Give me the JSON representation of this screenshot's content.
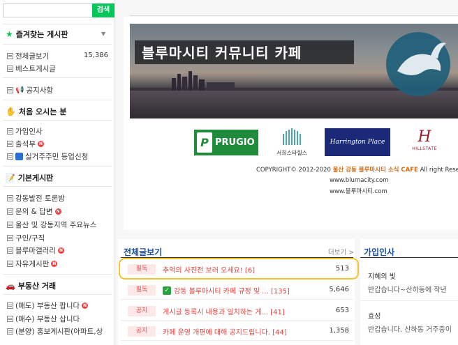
{
  "search": {
    "placeholder": "",
    "button": "검색"
  },
  "sidebar": {
    "favorites_title": "즐겨찾는 게시판",
    "items_top": [
      {
        "label": "전체글보기",
        "count": "15,386"
      },
      {
        "label": "베스트게시글"
      }
    ],
    "notice": "공지사항",
    "first_visit_title": "처음 오시는 분",
    "first_visit_items": [
      {
        "label": "가입인사"
      },
      {
        "label": "출석부"
      },
      {
        "label": "실거주주민 등업신청"
      }
    ],
    "basic_title": "기본게시판",
    "basic_items": [
      {
        "label": "강동발전 토론방"
      },
      {
        "label": "문의 & 답변"
      },
      {
        "label": "울산 및 강동지역 주요뉴스"
      },
      {
        "label": "구인/구직"
      },
      {
        "label": "블루마갤러리"
      },
      {
        "label": "자유게시판"
      }
    ],
    "realestate_title": "부동산 거래",
    "realestate_items": [
      {
        "label": "(매도) 부동산 팝니다"
      },
      {
        "label": "(매수) 부동산 삽니다"
      },
      {
        "label": "(분양) 홍보게시판(아파트,상"
      }
    ]
  },
  "banner": {
    "title": "블루마시티 커뮤니티 카페",
    "logos": {
      "prugio": "PRUGIO",
      "seohee": "서희스타힐스",
      "harrington": "Harrington Place",
      "hillstate": "HILLSTATE"
    },
    "copyright_prefix": "COPYRIGHT© 2012-2020",
    "copyright_cafe": "울산 강동 블루마시티 소식 CAFE",
    "copyright_suffix": "All right Reserved",
    "url1": "www.blumacity.com",
    "url2": "www.블루마시티.com"
  },
  "board": {
    "title": "전체글보기",
    "more": "더보기 >",
    "rows": [
      {
        "tag": "필독",
        "title": "추억의 사진전 보러 오세요! [6]",
        "count": "513",
        "check": false
      },
      {
        "tag": "필독",
        "title": "강동 블루마시티 카페 규정 및 ... [135]",
        "count": "5,646",
        "check": true
      },
      {
        "tag": "공지",
        "title": "게시글 등록시 내용과 일치하는 게... [41]",
        "count": "653",
        "check": false
      },
      {
        "tag": "공지",
        "title": "카페 운영 개편에 대해 공지드립니다. [44]",
        "count": "1,358",
        "check": false
      }
    ]
  },
  "welcome": {
    "title": "가입인사",
    "entries": [
      {
        "name": "지혜의 빛",
        "message": "반갑습니다~산하동에 작년"
      },
      {
        "name": "효성",
        "message": "반갑습니다. 산하동 거주중이"
      }
    ]
  },
  "colors": {
    "accent_green": "#03c75a",
    "title_blue": "#1a4ea0",
    "notice_red": "#e8413b",
    "highlight": "#f3c431"
  }
}
